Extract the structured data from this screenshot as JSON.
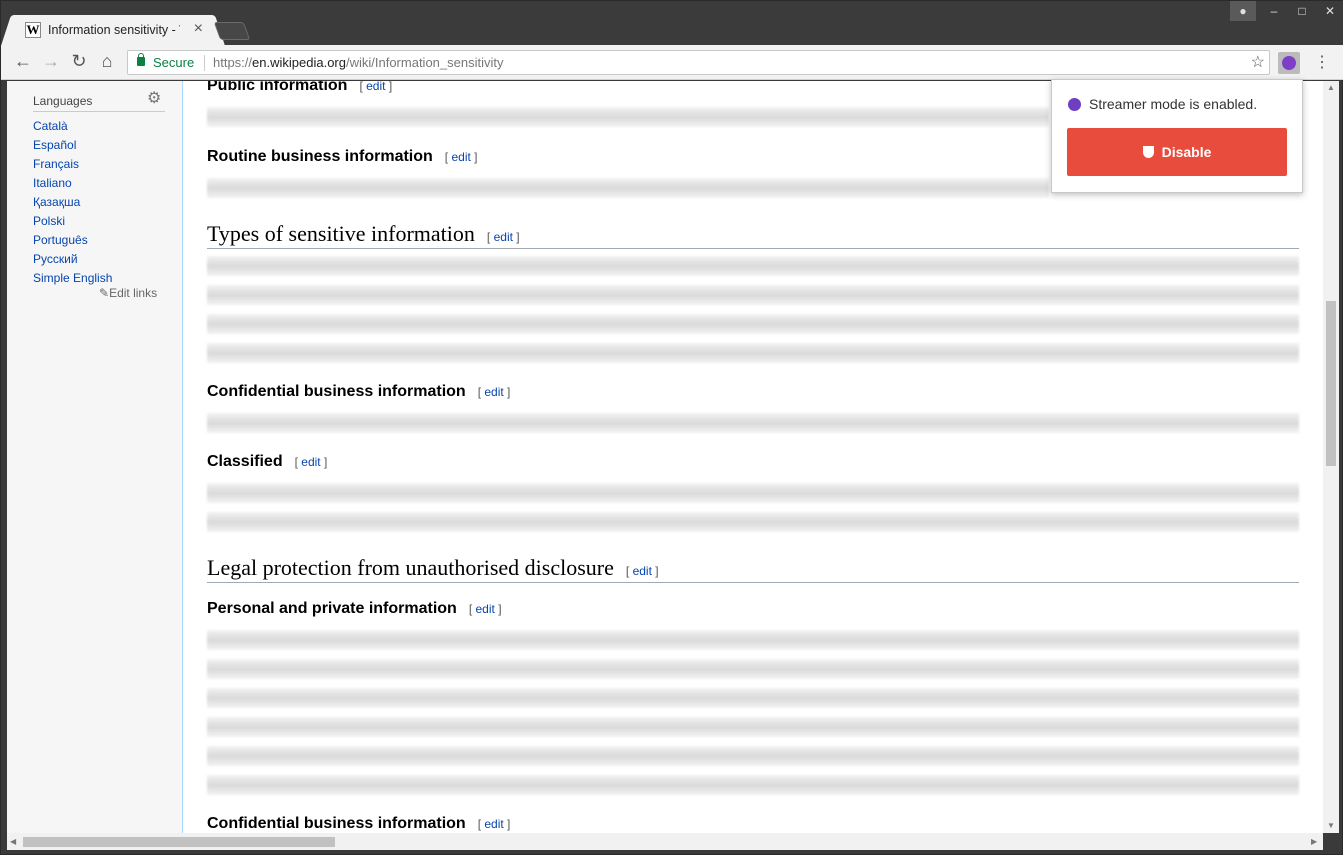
{
  "browser": {
    "tab_title": "Information sensitivity - W",
    "secure_label": "Secure",
    "url_scheme": "https://",
    "url_host": "en.wikipedia.org",
    "url_path": "/wiki/Information_sensitivity"
  },
  "sidebar": {
    "heading": "Languages",
    "languages": [
      "Català",
      "Español",
      "Français",
      "Italiano",
      "Қазақша",
      "Polski",
      "Português",
      "Русский",
      "Simple English"
    ],
    "edit_links": "Edit links"
  },
  "article": {
    "edit": "edit",
    "sections": [
      {
        "level": 3,
        "title": "Public information"
      },
      {
        "level": 3,
        "title": "Routine business information"
      },
      {
        "level": 2,
        "title": "Types of sensitive information"
      },
      {
        "level": 3,
        "title": "Confidential business information"
      },
      {
        "level": 3,
        "title": "Classified"
      },
      {
        "level": 2,
        "title": "Legal protection from unauthorised disclosure"
      },
      {
        "level": 3,
        "title": "Personal and private information"
      },
      {
        "level": 3,
        "title": "Confidential business information"
      }
    ]
  },
  "popup": {
    "status_text": "Streamer mode is enabled.",
    "disable_label": "Disable",
    "status_color": "#6e3fc1",
    "button_color": "#e74c3c"
  }
}
